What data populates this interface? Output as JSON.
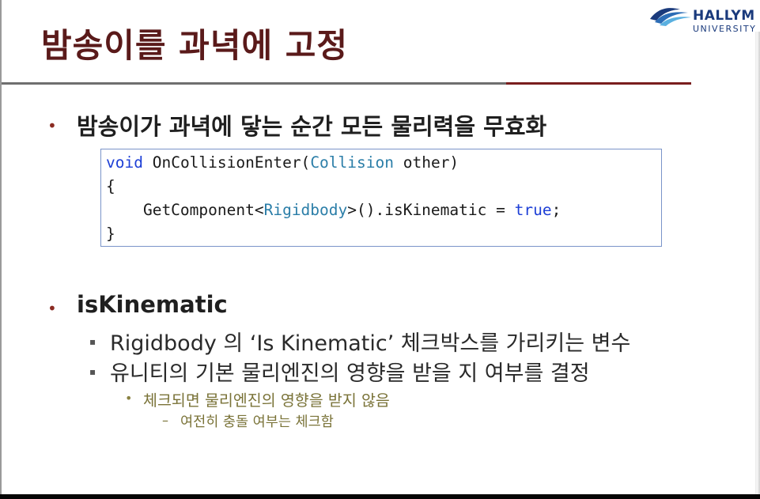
{
  "title": "밤송이를 과녁에 고정",
  "logo": {
    "name": "HALLYM",
    "sub": "UNIVERSITY"
  },
  "bullets": {
    "b1": "밤송이가 과녁에 닿는 순간 모든 물리력을 무효화",
    "b2": "isKinematic"
  },
  "code": {
    "l1": {
      "kw": "void",
      "fn": "OnCollisionEnter(",
      "ty": "Collision",
      "rest": "other)"
    },
    "l2": "{",
    "l3": {
      "pre": "    GetComponent<",
      "ty": "Rigidbody",
      "mid": ">().isKinematic = ",
      "kw": "true",
      "end": ";"
    },
    "l4": "}"
  },
  "sub": {
    "s1": "Rigidbody 의 ‘Is Kinematic’ 체크박스를 가리키는 변수",
    "s2": "유니티의 기본 물리엔진의 영향을 받을 지 여부를 결정",
    "s3": "체크되면 물리엔진의 영향을 받지 않음",
    "s4": "여전히 충돌 여부는 체크함"
  },
  "markers": {
    "bullet": "•",
    "square": "▪",
    "dot": "•",
    "dash": "–"
  },
  "colors": {
    "title": "#5a1a1a",
    "accent_rule": "#7a1e1e",
    "keyword": "#1d3fd6",
    "type": "#2b7ea8",
    "olive": "#7a7338"
  }
}
